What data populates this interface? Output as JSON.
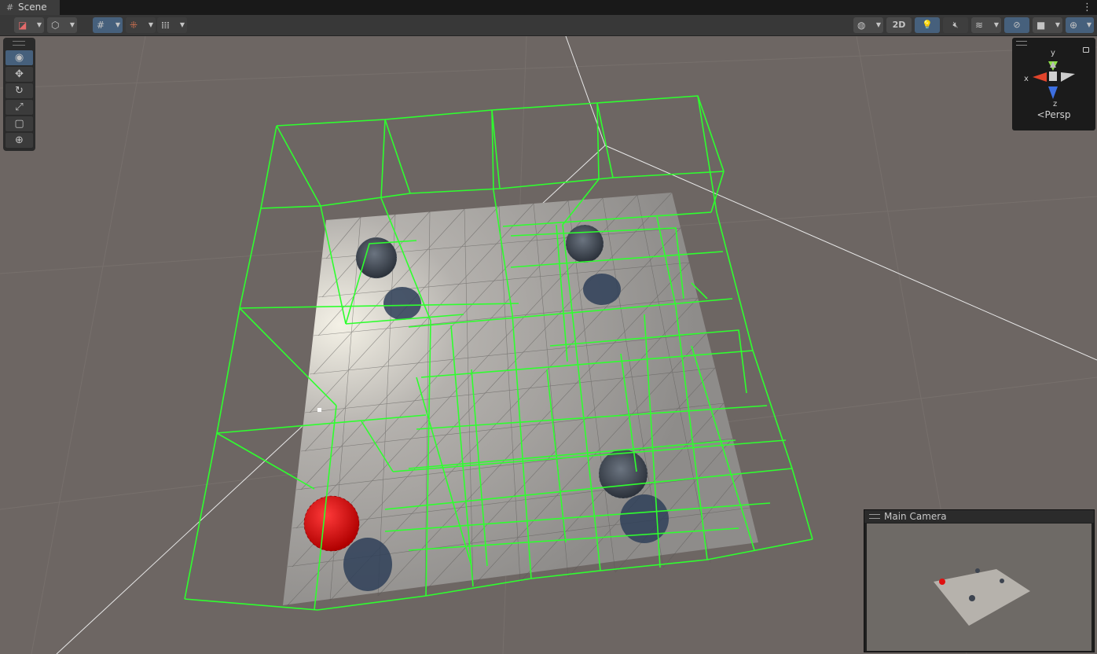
{
  "window": {
    "tab_title": "Scene",
    "tab_icon": "grid-icon",
    "menu_icon": "kebab-menu-icon"
  },
  "toolbar": {
    "left": [
      {
        "icon": "draw-mode-icon",
        "dropdown": true
      },
      {
        "icon": "render-cube-icon",
        "dropdown": true
      },
      {
        "icon": "grid-snap-icon",
        "dropdown": true,
        "active": true
      },
      {
        "icon": "snap-increment-icon",
        "dropdown": true
      },
      {
        "icon": "ruler-icon",
        "dropdown": true
      }
    ],
    "right": [
      {
        "icon": "globe-icon",
        "dropdown": true
      },
      {
        "label": "2D"
      },
      {
        "icon": "lightbulb-icon",
        "active": true
      },
      {
        "icon": "audio-mute-icon"
      },
      {
        "icon": "effects-layers-icon",
        "dropdown": true
      },
      {
        "icon": "visibility-hidden-icon",
        "active": true
      },
      {
        "icon": "camera-icon",
        "dropdown": true
      },
      {
        "icon": "gizmos-icon",
        "dropdown": true,
        "active": true
      }
    ]
  },
  "tools": [
    {
      "name": "view-tool",
      "icon": "eye-icon",
      "selected": true
    },
    {
      "name": "move-tool",
      "icon": "move-arrows-icon"
    },
    {
      "name": "rotate-tool",
      "icon": "rotate-icon"
    },
    {
      "name": "scale-tool",
      "icon": "scale-icon"
    },
    {
      "name": "rect-tool",
      "icon": "rect-transform-icon"
    },
    {
      "name": "transform-tool",
      "icon": "transform-icon"
    }
  ],
  "gizmo": {
    "axes": {
      "x": "x",
      "y": "y",
      "z": "z"
    },
    "projection": "Persp",
    "colors": {
      "x": "#e0442b",
      "y": "#8fe04b",
      "z": "#3d6fe0"
    }
  },
  "camera_preview": {
    "title": "Main Camera"
  },
  "scene": {
    "colors": {
      "background": "#6d6663",
      "ground": "#a09d9a",
      "wireframe": "#2eff2e",
      "red_ball": "#e01010",
      "dark_ball": "#3d4450"
    }
  }
}
